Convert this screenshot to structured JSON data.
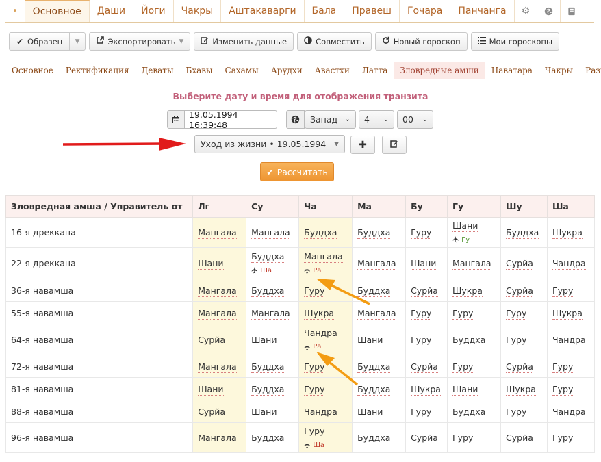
{
  "top_tabs": {
    "items": [
      "Основное",
      "Даши",
      "Йоги",
      "Чакры",
      "Аштакаварги",
      "Бала",
      "Правеш",
      "Гочара",
      "Панчанга"
    ],
    "active": "Основное",
    "icons": [
      "gear-icon",
      "globe-icon",
      "book-icon"
    ]
  },
  "toolbar": {
    "sample": "Образец",
    "export": "Экспортировать",
    "edit": "Изменить данные",
    "combine": "Совместить",
    "new": "Новый гороскоп",
    "mine": "Мои гороскопы"
  },
  "sub_tabs": {
    "items": [
      "Основное",
      "Ректификация",
      "Деваты",
      "Бхавы",
      "Сахамы",
      "Арудхи",
      "Авастхи",
      "Латта",
      "Зловредные амши",
      "Наватара",
      "Чакры",
      "Разное"
    ],
    "active": "Зловредные амши"
  },
  "heading": "Выберите дату и время для отображения транзита",
  "date": {
    "value": "19.05.1994 16:39:48"
  },
  "timezone": {
    "direction": "Запад",
    "hours": "4",
    "minutes": "00"
  },
  "event": {
    "value": "Уход из жизни • 19.05.1994"
  },
  "calc_label": "Рассчитать",
  "table": {
    "headers": [
      "Зловредная амша / Управитель от",
      "Лг",
      "Су",
      "Ча",
      "Ма",
      "Бу",
      "Гу",
      "Шу",
      "Ша"
    ],
    "rows": [
      {
        "label": "16-я дреккана",
        "cells": [
          {
            "v": "Мангала"
          },
          {
            "v": "Мангала"
          },
          {
            "v": "Буддха"
          },
          {
            "v": "Буддха"
          },
          {
            "v": "Гуру"
          },
          {
            "v": "Шани",
            "s": "Гу",
            "sc": "green"
          },
          {
            "v": "Буддха"
          },
          {
            "v": "Шукра"
          }
        ]
      },
      {
        "label": "22-я дреккана",
        "cells": [
          {
            "v": "Шани"
          },
          {
            "v": "Буддха",
            "s": "Ша",
            "sc": "red"
          },
          {
            "v": "Мангала",
            "s": "Ра",
            "sc": "red"
          },
          {
            "v": "Мангала"
          },
          {
            "v": "Шани"
          },
          {
            "v": "Мангала"
          },
          {
            "v": "Сурйа"
          },
          {
            "v": "Чандра"
          }
        ]
      },
      {
        "label": "36-я навамша",
        "cells": [
          {
            "v": "Мангала"
          },
          {
            "v": "Буддха"
          },
          {
            "v": "Гуру"
          },
          {
            "v": "Буддха"
          },
          {
            "v": "Сурйа"
          },
          {
            "v": "Шукра"
          },
          {
            "v": "Сурйа"
          },
          {
            "v": "Гуру"
          }
        ]
      },
      {
        "label": "55-я навамша",
        "cells": [
          {
            "v": "Мангала"
          },
          {
            "v": "Мангала"
          },
          {
            "v": "Шукра"
          },
          {
            "v": "Мангала"
          },
          {
            "v": "Гуру"
          },
          {
            "v": "Гуру"
          },
          {
            "v": "Гуру"
          },
          {
            "v": "Шукра"
          }
        ]
      },
      {
        "label": "64-я навамша",
        "cells": [
          {
            "v": "Сурйа"
          },
          {
            "v": "Шани"
          },
          {
            "v": "Чандра",
            "s": "Ра",
            "sc": "red"
          },
          {
            "v": "Шани"
          },
          {
            "v": "Гуру"
          },
          {
            "v": "Буддха"
          },
          {
            "v": "Гуру"
          },
          {
            "v": "Чандра"
          }
        ]
      },
      {
        "label": "72-я навамша",
        "cells": [
          {
            "v": "Мангала"
          },
          {
            "v": "Буддха"
          },
          {
            "v": "Гуру"
          },
          {
            "v": "Буддха"
          },
          {
            "v": "Сурйа"
          },
          {
            "v": "Гуру"
          },
          {
            "v": "Сурйа"
          },
          {
            "v": "Гуру"
          }
        ]
      },
      {
        "label": "81-я навамша",
        "cells": [
          {
            "v": "Шани"
          },
          {
            "v": "Буддха"
          },
          {
            "v": "Гуру"
          },
          {
            "v": "Буддха"
          },
          {
            "v": "Шукра"
          },
          {
            "v": "Шани"
          },
          {
            "v": "Шукра"
          },
          {
            "v": "Гуру"
          }
        ]
      },
      {
        "label": "88-я навамша",
        "cells": [
          {
            "v": "Сурйа"
          },
          {
            "v": "Шани"
          },
          {
            "v": "Чандра"
          },
          {
            "v": "Шани"
          },
          {
            "v": "Гуру"
          },
          {
            "v": "Буддха"
          },
          {
            "v": "Гуру"
          },
          {
            "v": "Чандра"
          }
        ]
      },
      {
        "label": "96-я навамша",
        "cells": [
          {
            "v": "Мангала"
          },
          {
            "v": "Буддха"
          },
          {
            "v": "Гуру",
            "s": "Ша",
            "sc": "red"
          },
          {
            "v": "Буддха"
          },
          {
            "v": "Сурйа"
          },
          {
            "v": "Гуру"
          },
          {
            "v": "Сурйа"
          },
          {
            "v": "Гуру"
          }
        ]
      }
    ]
  },
  "colors": {
    "accent": "#b3672a",
    "heading": "#c2607a",
    "calc_button": "#ee9531",
    "highlight_column": "#fdf8dc",
    "annotation_red": "#e11b1b",
    "annotation_orange": "#f39c12"
  }
}
